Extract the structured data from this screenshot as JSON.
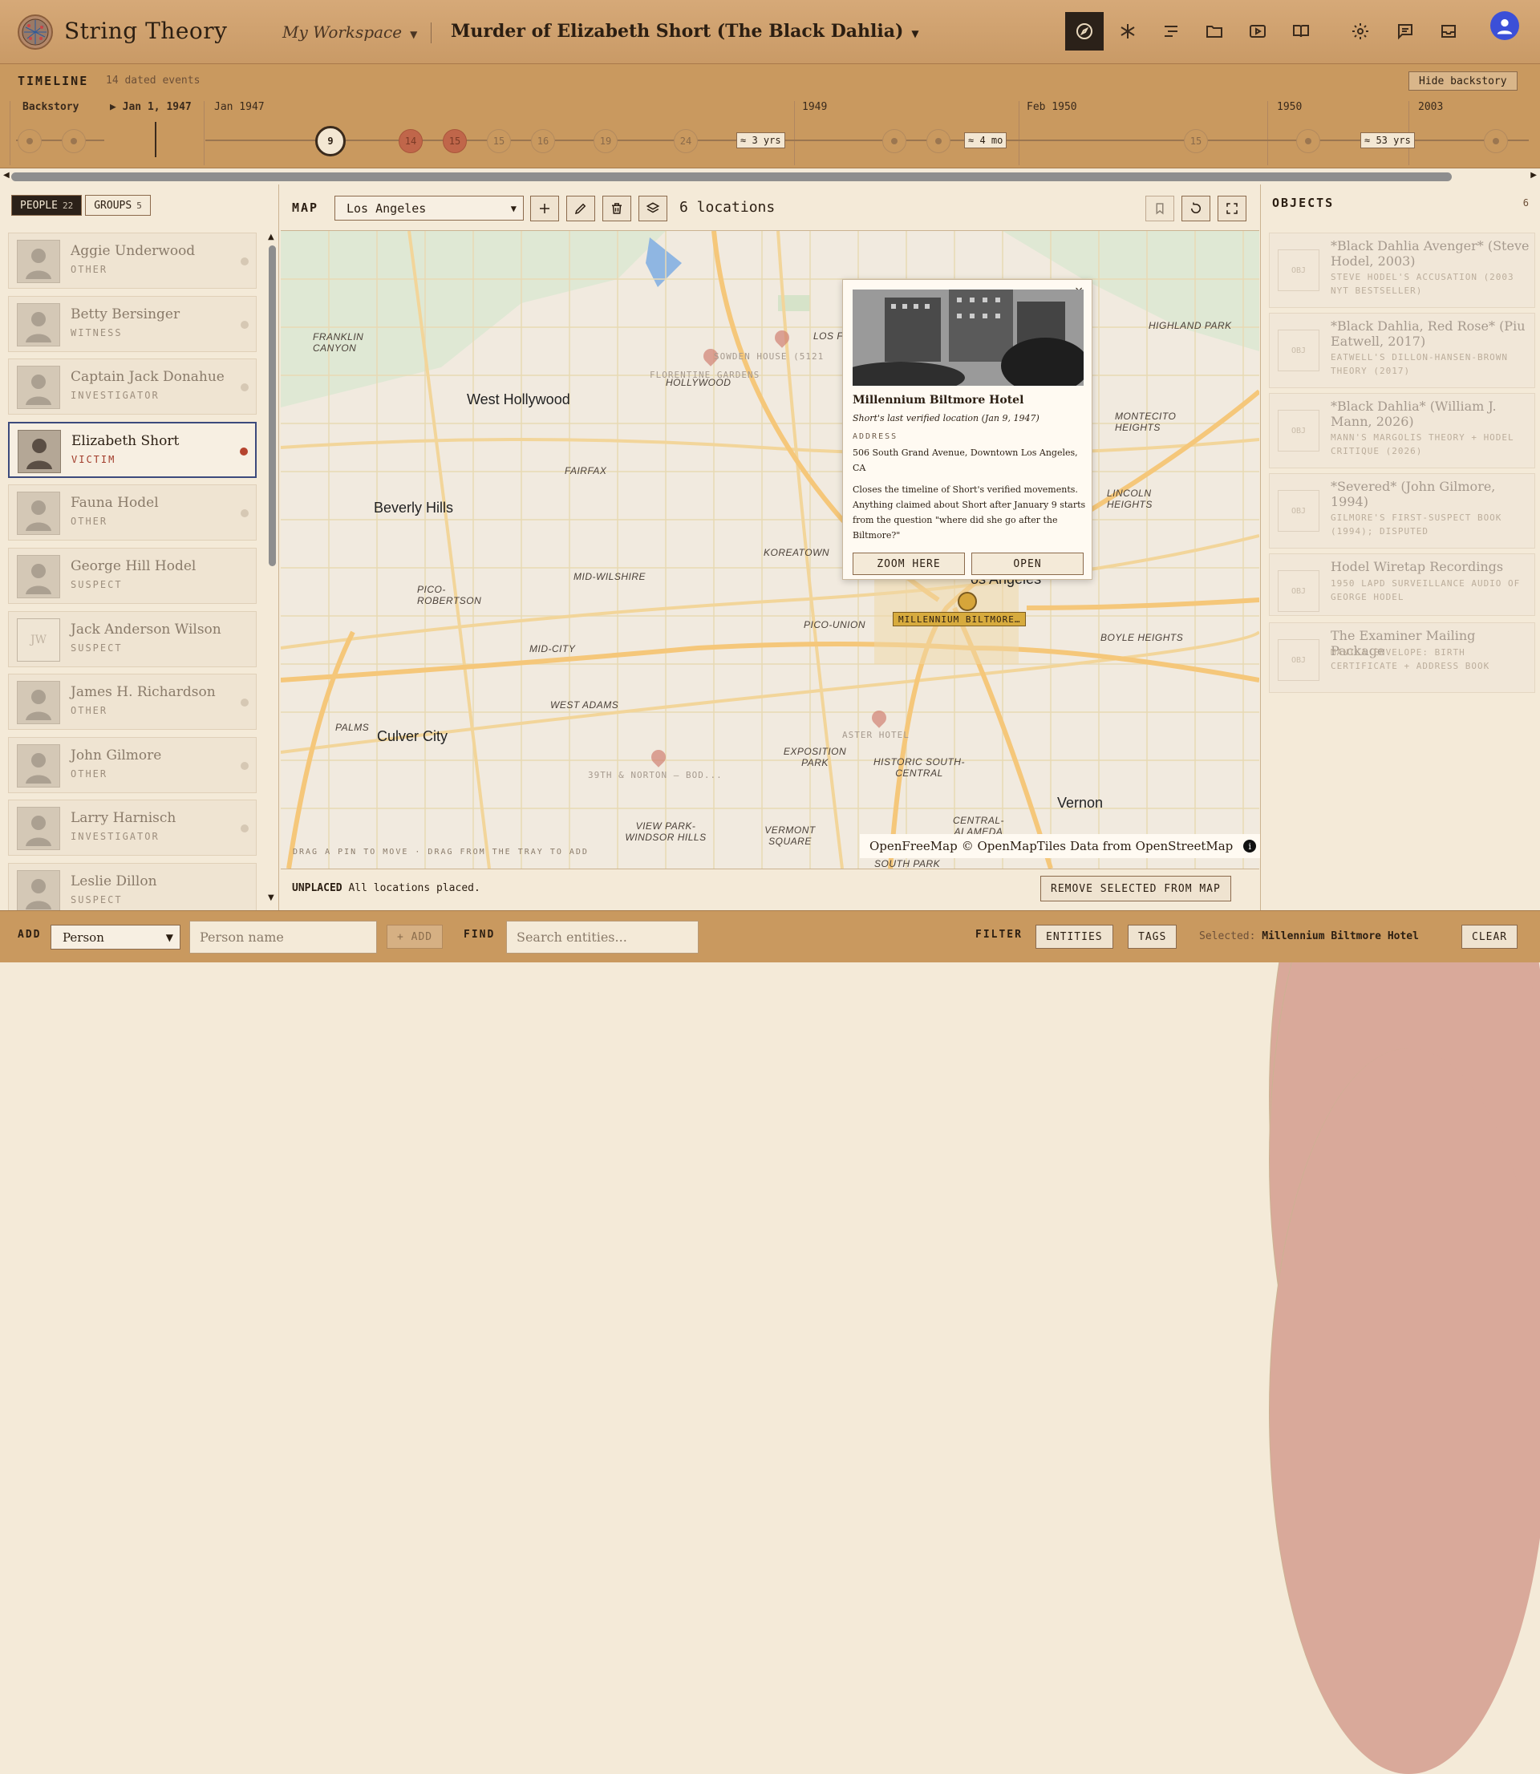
{
  "app": {
    "name": "String Theory"
  },
  "header": {
    "workspace": "My Workspace",
    "case_title": "Murder of Elizabeth Short (The Black Dahlia)",
    "toolbar_icons": [
      "compass-icon",
      "asterisk-icon",
      "timeline-list-icon",
      "folder-icon",
      "play-icon",
      "book-icon"
    ],
    "right_icons": [
      "gear-icon",
      "chat-icon",
      "inbox-icon",
      "user-avatar-icon"
    ]
  },
  "timeline": {
    "title": "TIMELINE",
    "count": "14 dated events",
    "hide_button": "Hide backstory",
    "lanes": [
      "Backstory",
      "▶ Jan 1, 1947",
      "Jan 1947",
      "1949",
      "Feb 1950",
      "1950",
      "2003"
    ],
    "events": [
      "9",
      "14",
      "15",
      "15",
      "16",
      "19",
      "24",
      "15"
    ],
    "gaps": [
      "≈ 3 yrs",
      "≈ 4 mo",
      "≈ 53 yrs"
    ]
  },
  "people_panel": {
    "tab_people": "PEOPLE",
    "people_count": "22",
    "tab_groups": "GROUPS",
    "groups_count": "5",
    "people": [
      {
        "name": "Aggie Underwood",
        "role": "OTHER",
        "initials": ""
      },
      {
        "name": "Betty Bersinger",
        "role": "WITNESS",
        "initials": ""
      },
      {
        "name": "Captain Jack Donahue",
        "role": "INVESTIGATOR",
        "initials": ""
      },
      {
        "name": "Elizabeth Short",
        "role": "VICTIM",
        "initials": ""
      },
      {
        "name": "Fauna Hodel",
        "role": "OTHER",
        "initials": ""
      },
      {
        "name": "George Hill Hodel",
        "role": "SUSPECT",
        "initials": ""
      },
      {
        "name": "Jack Anderson Wilson",
        "role": "SUSPECT",
        "initials": "JW"
      },
      {
        "name": "James H. Richardson",
        "role": "OTHER",
        "initials": ""
      },
      {
        "name": "John Gilmore",
        "role": "OTHER",
        "initials": ""
      },
      {
        "name": "Larry Harnisch",
        "role": "INVESTIGATOR",
        "initials": ""
      },
      {
        "name": "Leslie Dillon",
        "role": "SUSPECT",
        "initials": ""
      }
    ]
  },
  "map_panel": {
    "label": "MAP",
    "region": "Los Angeles",
    "locations": "6 locations",
    "hint": "DRAG A PIN TO MOVE · DRAG FROM THE TRAY TO ADD",
    "attribution_a": "OpenFreeMap",
    "attribution_b": "© OpenMapTiles",
    "attribution_c": "Data from",
    "attribution_d": "OpenStreetMap",
    "place_labels": [
      "West Hollywood",
      "Beverly Hills",
      "Culver City",
      "Vernon",
      "HOLLYWOOD",
      "FRANKLIN CANYON",
      "FAIRFAX",
      "KOREATOWN",
      "MID-WILSHIRE",
      "PICO-ROBERTSON",
      "MID-CITY",
      "PICO-UNION",
      "WEST ADAMS",
      "PALMS",
      "EXPOSITION PARK",
      "HISTORIC SOUTH-CENTRAL",
      "VIEW PARK-WINDSOR HILLS",
      "VERMONT SQUARE",
      "CENTRAL-ALAMEDA",
      "SOUTH PARK",
      "BOYLE HEIGHTS",
      "LINCOLN HEIGHTS",
      "MONTECITO HEIGHTS",
      "HIGHLAND PARK",
      "LOS F",
      "os Angeles"
    ],
    "ghost_pins": [
      "SOWDEN HOUSE (5121",
      "FLORENTINE GARDENS",
      "ASTER HOTEL",
      "39TH & NORTON — BOD..."
    ],
    "selected_pin": "MILLENNIUM BILTMORE…",
    "popup": {
      "title": "Millennium Biltmore Hotel",
      "subtitle": "Short's last verified location (Jan 9, 1947)",
      "address_label": "ADDRESS",
      "address": "506 South Grand Avenue, Downtown Los Angeles, CA",
      "description": "Closes the timeline of Short's verified movements. Anything claimed about Short after January 9 starts from the question \"where did she go after the Biltmore?\"",
      "zoom_button": "ZOOM HERE",
      "open_button": "OPEN"
    },
    "unplaced_label": "UNPLACED",
    "unplaced_text": "All locations placed.",
    "remove_button": "REMOVE SELECTED FROM MAP"
  },
  "objects_panel": {
    "title": "OBJECTS",
    "count": "6",
    "icon_text": "OBJ",
    "objects": [
      {
        "title": "*Black Dahlia Avenger* (Steve Hodel, 2003)",
        "desc": "STEVE HODEL'S ACCUSATION (2003 NYT BESTSELLER)"
      },
      {
        "title": "*Black Dahlia, Red Rose* (Piu Eatwell, 2017)",
        "desc": "EATWELL'S DILLON-HANSEN-BROWN THEORY (2017)"
      },
      {
        "title": "*Black Dahlia* (William J. Mann, 2026)",
        "desc": "MANN'S MARGOLIS THEORY + HODEL CRITIQUE (2026)"
      },
      {
        "title": "*Severed* (John Gilmore, 1994)",
        "desc": "GILMORE'S FIRST-SUSPECT BOOK (1994); DISPUTED"
      },
      {
        "title": "Hodel Wiretap Recordings",
        "desc": "1950 LAPD SURVEILLANCE AUDIO OF GEORGE HODEL"
      },
      {
        "title": "The Examiner Mailing Package",
        "desc": "MANILA ENVELOPE: BIRTH CERTIFICATE + ADDRESS BOOK"
      }
    ]
  },
  "bottom_bar": {
    "add_label": "ADD",
    "type_value": "Person",
    "name_placeholder": "Person name",
    "add_button": "+ ADD",
    "find_label": "FIND",
    "find_placeholder": "Search entities...",
    "filter_label": "FILTER",
    "entities_button": "ENTITIES",
    "tags_button": "TAGS",
    "selected_label": "Selected:",
    "selected_value": "Millennium Biltmore Hotel",
    "clear_button": "CLEAR"
  },
  "colors": {
    "accent": "#c9995f",
    "victim": "#b5432e",
    "selected_pin": "#d6a53a",
    "avatar": "#3b4fd8"
  }
}
